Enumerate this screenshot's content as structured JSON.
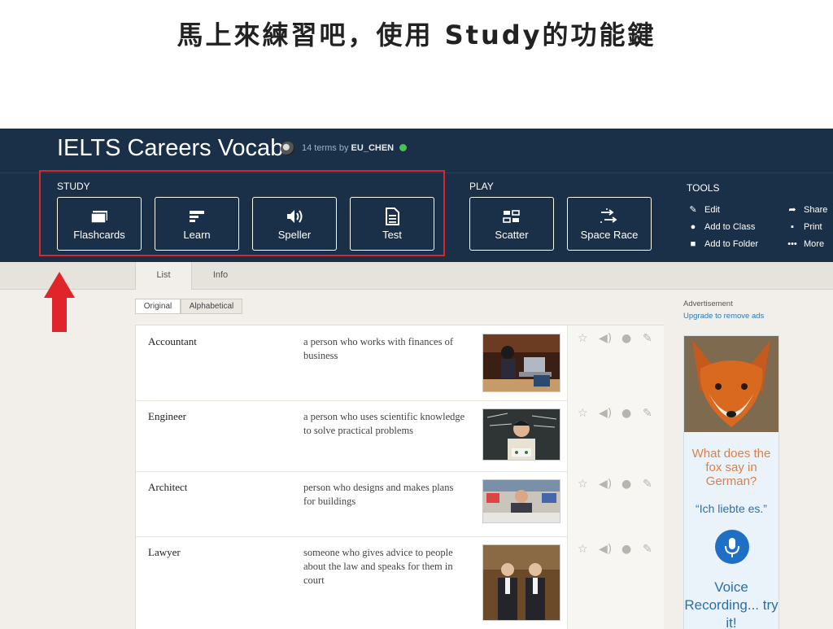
{
  "slide": {
    "title": "馬上來練習吧，使用 Study的功能鍵"
  },
  "colors": {
    "header_bg": "#1a3048",
    "highlight": "#d9272e",
    "arrow": "#e1232a",
    "online": "#4bc24b",
    "link": "#2a7ab8"
  },
  "set": {
    "title": "IELTS Careers Vocab",
    "terms_count": "14 terms",
    "by": "by",
    "owner": "EU_CHEN"
  },
  "study": {
    "label": "STUDY",
    "modes": [
      {
        "label": "Flashcards",
        "icon": "flashcards-icon"
      },
      {
        "label": "Learn",
        "icon": "learn-icon"
      },
      {
        "label": "Speller",
        "icon": "speaker-icon"
      },
      {
        "label": "Test",
        "icon": "test-document-icon"
      }
    ]
  },
  "play": {
    "label": "PLAY",
    "modes": [
      {
        "label": "Scatter",
        "icon": "scatter-grid-icon"
      },
      {
        "label": "Space Race",
        "icon": "space-race-arrows-icon"
      }
    ]
  },
  "tools": {
    "label": "TOOLS",
    "items": [
      {
        "label": "Edit",
        "icon": "pencil-icon"
      },
      {
        "label": "Add to Class",
        "icon": "users-icon"
      },
      {
        "label": "Add to Folder",
        "icon": "folder-icon"
      },
      {
        "label": "Share",
        "icon": "share-arrow-icon"
      },
      {
        "label": "Print",
        "icon": "printer-icon"
      },
      {
        "label": "More",
        "icon": "more-dots-icon"
      }
    ]
  },
  "tabs": [
    {
      "label": "List",
      "active": true
    },
    {
      "label": "Info",
      "active": false
    }
  ],
  "sort": [
    {
      "label": "Original",
      "active": true
    },
    {
      "label": "Alphabetical",
      "active": false
    }
  ],
  "terms": [
    {
      "term": "Accountant",
      "definition": "a person who works with finances of business"
    },
    {
      "term": "Engineer",
      "definition": "a person who uses scientific knowledge to solve practical problems"
    },
    {
      "term": "Architect",
      "definition": "person who designs and makes plans for buildings"
    },
    {
      "term": "Lawyer",
      "definition": "someone who gives advice to people about the law and speaks for them in court"
    }
  ],
  "ad": {
    "label": "Advertisement",
    "upgrade": "Upgrade to remove ads",
    "question": "What does the fox say in German?",
    "answer": "“Ich liebte es.”",
    "cta": "Voice Recording... try it!"
  }
}
